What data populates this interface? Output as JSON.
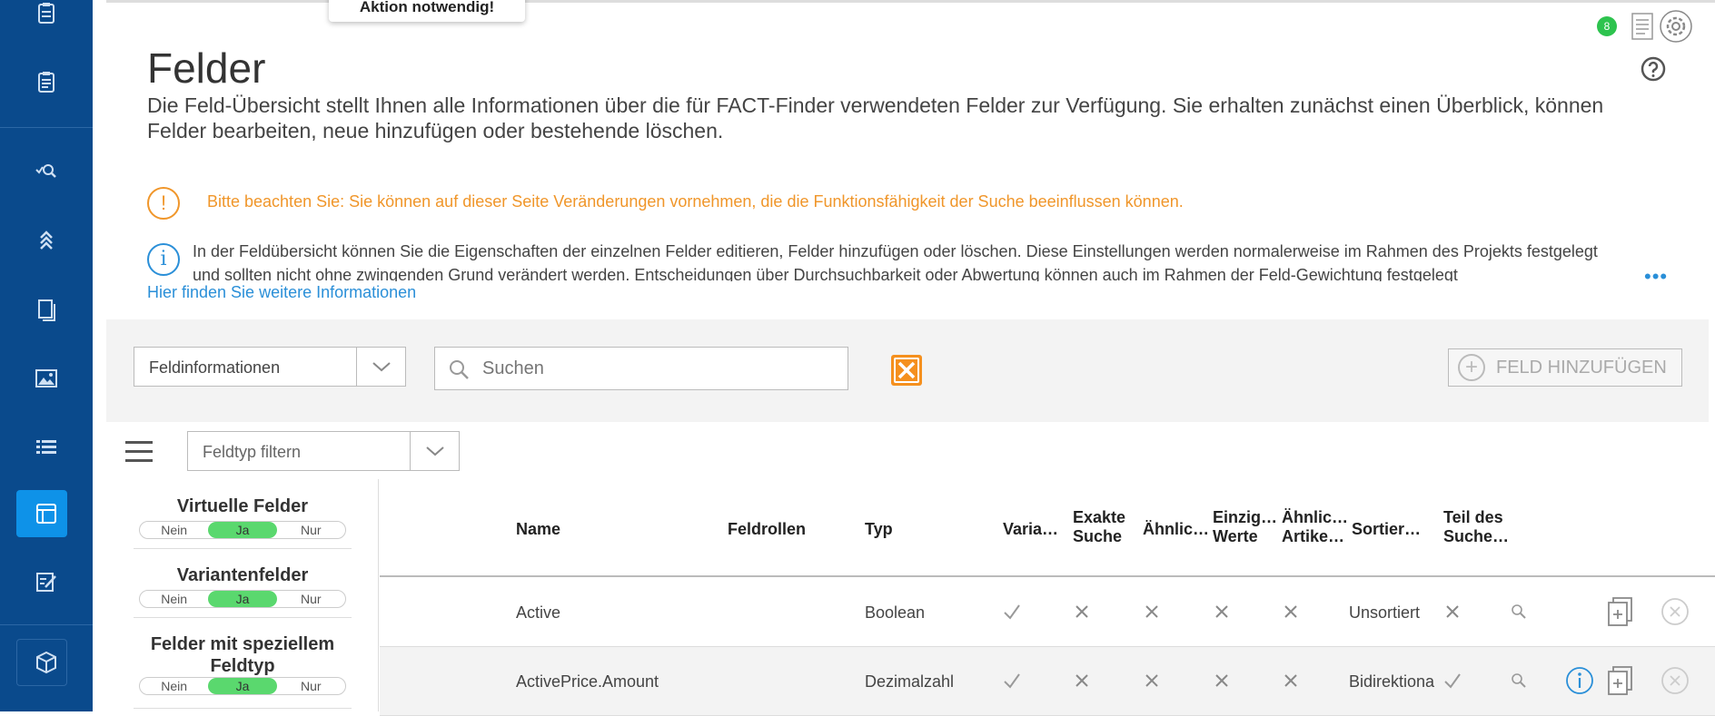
{
  "toast": {
    "text": "Aktion notwendig!"
  },
  "header": {
    "title": "Felder",
    "description": "Die Feld-Übersicht stellt Ihnen alle Informationen über die für FACT-Finder verwendeten Felder zur Verfügung. Sie erhalten zunächst einen Überblick, können Felder bearbeiten, neue hinzufügen oder bestehende löschen.",
    "notification_count": "8"
  },
  "notices": {
    "warning": "Bitte beachten Sie: Sie können auf dieser Seite Veränderungen vornehmen, die die Funktionsfähigkeit der Suche beeinflussen können.",
    "info": "In der Feldübersicht können Sie die Eigenschaften der einzelnen Felder editieren, Felder hinzufügen oder löschen. Diese Einstellungen werden normalerweise im Rahmen des Projekts festgelegt und sollten nicht ohne zwingenden Grund verändert werden. Entscheidungen über Durchsuchbarkeit oder Abwertung können auch im Rahmen der Feld-Gewichtung festgelegt",
    "more": "•••",
    "link": "Hier finden Sie weitere Informationen"
  },
  "toolbar": {
    "view_select": "Feldinformationen",
    "search_placeholder": "Suchen",
    "add_button": "FELD HINZUFÜGEN",
    "type_filter": "Feldtyp filtern"
  },
  "filters": [
    {
      "title": "Virtuelle Felder",
      "options": [
        "Nein",
        "Ja",
        "Nur"
      ],
      "selected": "Ja"
    },
    {
      "title": "Variantenfelder",
      "options": [
        "Nein",
        "Ja",
        "Nur"
      ],
      "selected": "Ja"
    },
    {
      "title": "Felder mit speziellem Feldtyp",
      "options": [
        "Nein",
        "Ja",
        "Nur"
      ],
      "selected": "Ja"
    }
  ],
  "table": {
    "columns": [
      "Name",
      "Feldrollen",
      "Typ",
      "Varia…",
      "Exakte Suche",
      "Ähnlic…",
      "Einzig… Werte",
      "Ähnlic… Artike…",
      "Sortier…",
      "Teil des Suche…"
    ],
    "rows": [
      {
        "name": "Active",
        "roles": "",
        "type": "Boolean",
        "variant": "check",
        "exact": "x",
        "similar": "x",
        "unique": "x",
        "similar_articles": "x",
        "sort": "Unsortiert",
        "search_part": "x"
      },
      {
        "name": "ActivePrice.Amount",
        "roles": "",
        "type": "Dezimalzahl",
        "variant": "check",
        "exact": "x",
        "similar": "x",
        "unique": "x",
        "similar_articles": "x",
        "sort": "Bidirektiona",
        "search_part": "check"
      }
    ]
  },
  "colors": {
    "sidebar": "#0a4a8c",
    "accent": "#2a8fd8",
    "warning": "#f0962a",
    "toggle_on": "#5ad86e",
    "clear": "#f5901e"
  }
}
